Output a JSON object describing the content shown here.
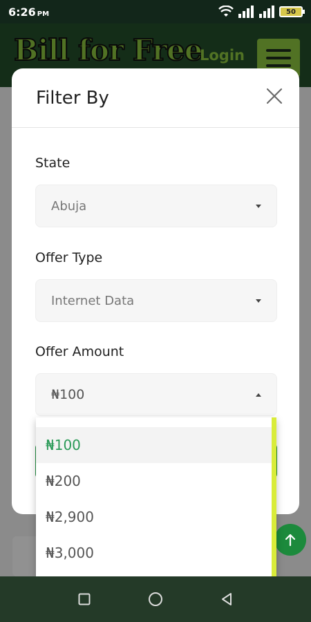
{
  "status_bar": {
    "time": "6:26",
    "ampm": "PM",
    "battery": "50"
  },
  "header": {
    "logo": "Bill for Free",
    "login": "Login"
  },
  "modal": {
    "title": "Filter By",
    "fields": [
      {
        "label": "State",
        "value": "Abuja"
      },
      {
        "label": "Offer Type",
        "value": "Internet Data"
      },
      {
        "label": "Offer Amount",
        "value": "₦100"
      }
    ]
  },
  "dropdown": {
    "options": [
      "₦100",
      "₦200",
      "₦2,900",
      "₦3,000"
    ],
    "selected_index": 0
  },
  "colors": {
    "accent": "#1c8a3c",
    "brand": "#8cc53f",
    "selected_text": "#2a9a57"
  }
}
